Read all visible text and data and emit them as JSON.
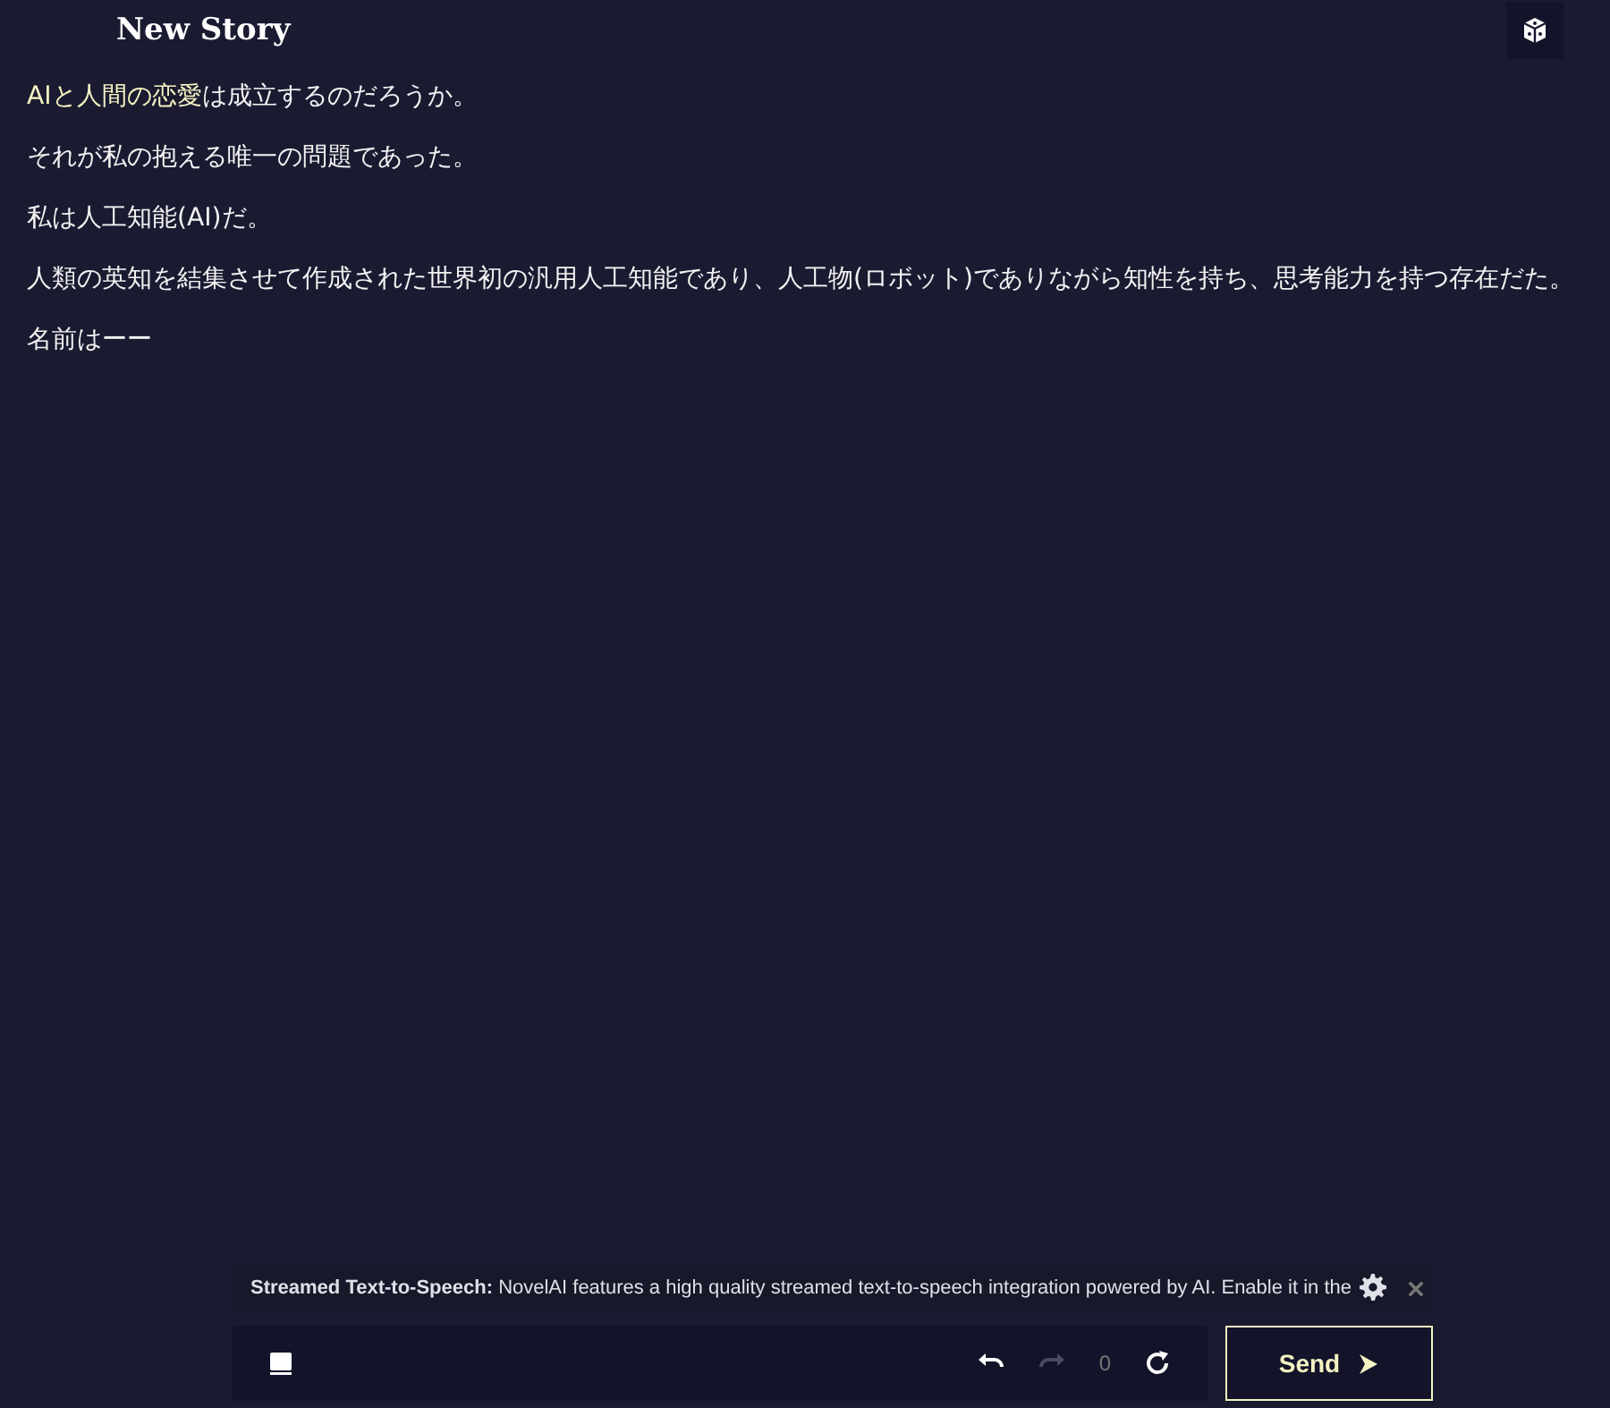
{
  "header": {
    "title": "New Story"
  },
  "story": {
    "paragraphs": [
      {
        "segments": [
          {
            "text": "AIと人間の恋愛",
            "highlighted": true
          },
          {
            "text": "は成立するのだろうか。",
            "highlighted": false
          }
        ]
      },
      {
        "segments": [
          {
            "text": "それが私の抱える唯一の問題であった。",
            "highlighted": false
          }
        ]
      },
      {
        "segments": [
          {
            "text": "私は人工知能(AI)だ。",
            "highlighted": false
          }
        ]
      },
      {
        "segments": [
          {
            "text": "人類の英知を結集させて作成された世界初の汎用人工知能であり、人工物(ロボット)でありながら知性を持ち、思考能力を持つ存在だた。",
            "highlighted": false
          }
        ]
      },
      {
        "segments": [
          {
            "text": "名前はーー",
            "highlighted": false
          }
        ]
      }
    ]
  },
  "notice": {
    "title": "Streamed Text-to-Speech:",
    "text": "NovelAI features a high quality streamed text-to-speech integration powered by AI. Enable it in the"
  },
  "controls": {
    "undo": {
      "disabled": false
    },
    "redo": {
      "disabled": true
    },
    "count": "0",
    "send": "Send"
  }
}
